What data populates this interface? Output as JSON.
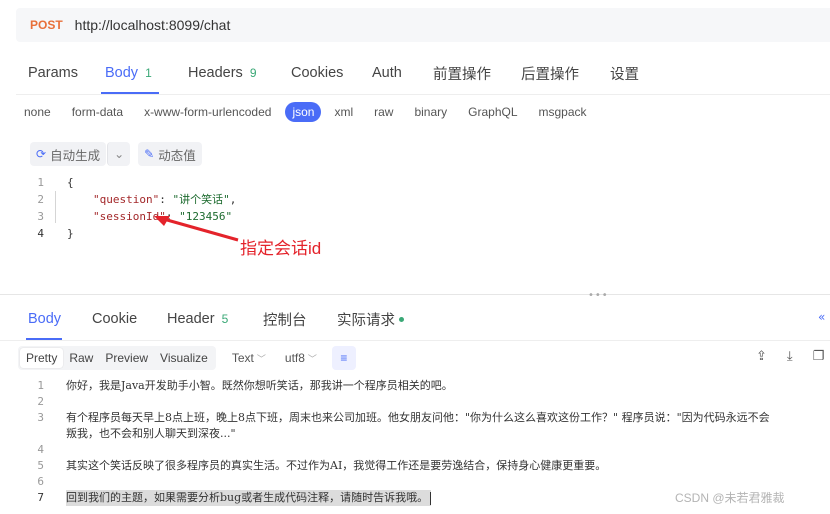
{
  "request": {
    "method": "POST",
    "url": "http://localhost:8099/chat"
  },
  "request_tabs": [
    {
      "label": "Params",
      "count": ""
    },
    {
      "label": "Body",
      "count": "1"
    },
    {
      "label": "Headers",
      "count": "9"
    },
    {
      "label": "Cookies",
      "count": ""
    },
    {
      "label": "Auth",
      "count": ""
    },
    {
      "label": "前置操作",
      "count": ""
    },
    {
      "label": "后置操作",
      "count": ""
    },
    {
      "label": "设置",
      "count": ""
    }
  ],
  "body_types": [
    "none",
    "form-data",
    "x-www-form-urlencoded",
    "json",
    "xml",
    "raw",
    "binary",
    "GraphQL",
    "msgpack"
  ],
  "body_toolbar": {
    "auto_generate": "自动生成",
    "dynamic_value": "动态值"
  },
  "editor": {
    "line_numbers": [
      "1",
      "2",
      "3",
      "4"
    ],
    "open_brace": "{",
    "key1": "\"question\"",
    "val1": "\"讲个笑话\"",
    "key2": "\"sessionId\"",
    "val2": "\"123456\"",
    "close_brace": "}",
    "colon": ": ",
    "comma": ","
  },
  "annotation": "指定会话id",
  "response_tabs": [
    {
      "label": "Body",
      "count": ""
    },
    {
      "label": "Cookie",
      "count": ""
    },
    {
      "label": "Header",
      "count": "5"
    },
    {
      "label": "控制台",
      "count": ""
    },
    {
      "label": "实际请求",
      "count": ""
    }
  ],
  "format_bar": {
    "modes": [
      "Pretty",
      "Raw",
      "Preview",
      "Visualize"
    ],
    "type": "Text",
    "encoding": "utf8"
  },
  "response_body": [
    {
      "n": "1",
      "text": "你好，我是Java开发助手小智。既然你想听笑话，那我讲一个程序员相关的吧。"
    },
    {
      "n": "2",
      "text": ""
    },
    {
      "n": "3",
      "text": "有个程序员每天早上8点上班，晚上8点下班，周末也来公司加班。他女朋友问他：\"你为什么这么喜欢这份工作？\" 程序员说：\"因为代码永远不会"
    },
    {
      "n": "",
      "text": "叛我，也不会和别人聊天到深夜...\""
    },
    {
      "n": "4",
      "text": ""
    },
    {
      "n": "5",
      "text": "其实这个笑话反映了很多程序员的真实生活。不过作为AI，我觉得工作还是要劳逸结合，保持身心健康更重要。"
    },
    {
      "n": "6",
      "text": ""
    },
    {
      "n": "7",
      "text": "回到我们的主题，如果需要分析bug或者生成代码注释，请随时告诉我哦。"
    }
  ],
  "watermark": "CSDN @未若君雅裁",
  "colors": {
    "accent": "#4a6cf7",
    "method": "#e8703a",
    "annotation": "#e4232b",
    "count": "#3aa876"
  }
}
